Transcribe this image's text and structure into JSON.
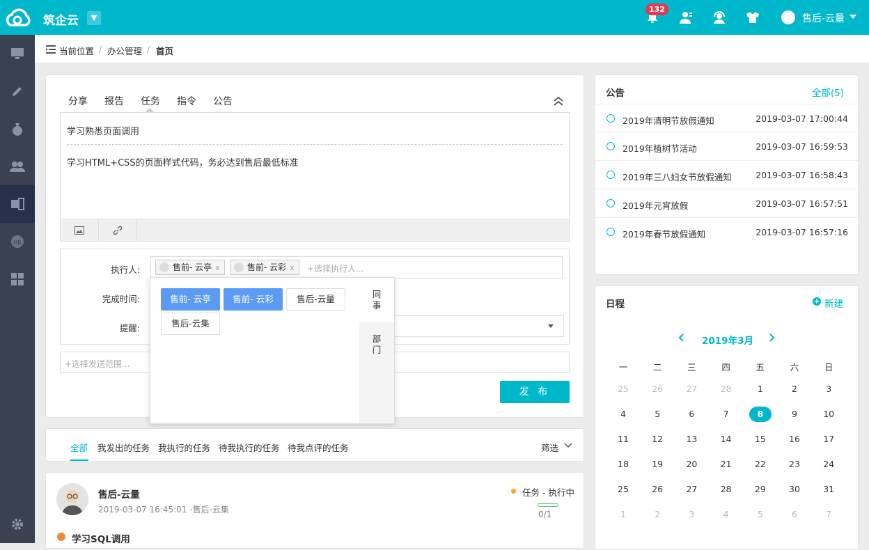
{
  "app": {
    "brand": "筑企云",
    "badge_count": "132",
    "user": "售后-云量"
  },
  "breadcrumb": {
    "label": "当前位置",
    "sep": "/",
    "level1": "办公管理",
    "level2": "首页"
  },
  "composer": {
    "tabs": [
      "分享",
      "报告",
      "任务",
      "指令",
      "公告"
    ],
    "title": "学习熟悉页面调用",
    "body": "学习HTML+CSS的页面样式代码，务必达到售后最低标准",
    "executor_label": "执行人:",
    "executors": [
      "售前- 云亭",
      "售前- 云彩"
    ],
    "executor_placeholder": "+选择执行人...",
    "deadline_label": "完成时间:",
    "reminder_label": "提醒:",
    "scope_placeholder": "+选择发送范围...",
    "publish": "发 布"
  },
  "picker": {
    "people": [
      {
        "name": "售前- 云亭",
        "selected": true
      },
      {
        "name": "售前- 云彩",
        "selected": true
      },
      {
        "name": "售后-云量",
        "selected": false
      },
      {
        "name": "售后-云集",
        "selected": false
      }
    ],
    "tab_colleague": [
      "同",
      "事"
    ],
    "tab_dept": [
      "部",
      "门"
    ]
  },
  "feed_filter": {
    "tabs": [
      "全部",
      "我发出的任务",
      "我执行的任务",
      "待我执行的任务",
      "待我点评的任务"
    ],
    "filter": "筛选"
  },
  "feed": {
    "author": "售后-云量",
    "meta": "2019-03-07 16:45:01 -售后-云集",
    "status": "任务 - 执行中",
    "progress_text": "0/1",
    "progress": 0,
    "title": "学习SQL调用"
  },
  "announcements": {
    "title": "公告",
    "all": "全部(5)",
    "items": [
      {
        "title": "2019年清明节放假通知",
        "date": "2019-03-07 17:00:44"
      },
      {
        "title": "2019年植树节活动",
        "date": "2019-03-07 16:59:53"
      },
      {
        "title": "2019年三八妇女节放假通知",
        "date": "2019-03-07 16:58:43"
      },
      {
        "title": "2019年元宵放假",
        "date": "2019-03-07 16:57:51"
      },
      {
        "title": "2019年春节放假通知",
        "date": "2019-03-07 16:57:16"
      }
    ]
  },
  "calendar": {
    "title": "日程",
    "new": "新建",
    "month": "2019年3月",
    "weekdays": [
      "一",
      "二",
      "三",
      "四",
      "五",
      "六",
      "日"
    ],
    "weeks": [
      [
        "25",
        "26",
        "27",
        "28",
        "1",
        "2",
        "3"
      ],
      [
        "4",
        "5",
        "6",
        "7",
        "8",
        "9",
        "10"
      ],
      [
        "11",
        "12",
        "13",
        "14",
        "15",
        "16",
        "17"
      ],
      [
        "18",
        "19",
        "20",
        "21",
        "22",
        "23",
        "24"
      ],
      [
        "25",
        "26",
        "27",
        "28",
        "29",
        "30",
        "31"
      ],
      [
        "1",
        "2",
        "3",
        "4",
        "5",
        "6",
        "7"
      ]
    ],
    "today": "8",
    "colors": {
      "accent": "#00b8cc",
      "selected": "#5b9bf4",
      "badge": "#e8384f",
      "status": "#f5a623"
    }
  }
}
